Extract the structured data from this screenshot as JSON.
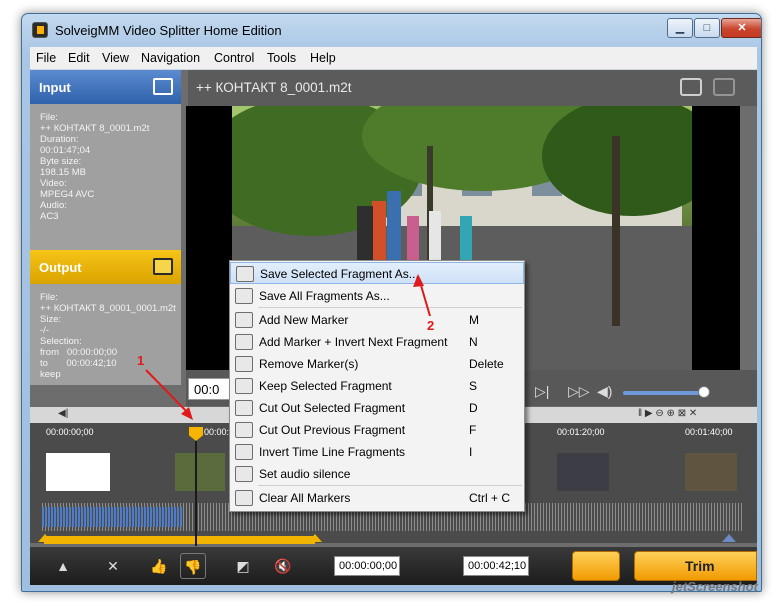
{
  "window": {
    "title": "SolveigMM Video Splitter Home Edition",
    "minimize": "▁",
    "maximize": "□",
    "close": "✕",
    "icon": "app-icon"
  },
  "menu": [
    "File",
    "Edit",
    "View",
    "Navigation",
    "Control",
    "Tools",
    "Help"
  ],
  "input_panel": {
    "header": "Input",
    "info": "File:\n++ КОНТАКТ 8_0001.m2t\nDuration:\n00:01:47;04\nByte size:\n198.15 MB\nVideo:\nMPEG4 AVC\nAudio:\nAC3",
    "icon": "folder-open-icon"
  },
  "output_panel": {
    "header": "Output",
    "info": "File:\n++ КОНТАКТ 8_0001_0001.m2t\nSize:\n-/-\nSelection:\nfrom   00:00:00;00\nto       00:00:42;10\nkeep",
    "icon": "floppy-disk-icon"
  },
  "video": {
    "title": "++ КОНТАКТ 8_0001.m2t",
    "timecode": "00:0",
    "camera_icon": "snapshot-icon",
    "volume": 0.9
  },
  "timeline": {
    "ruler": [
      "00:00:00;00",
      "00:00:20;00",
      "00:01:20;00",
      "00:01:40;00"
    ],
    "selection_fraction": 0.39
  },
  "bottom_bar": {
    "start_tc": "00:00:00;00",
    "end_tc": "00:00:42;10",
    "trim_label": "Trim"
  },
  "context_menu": [
    {
      "label": "Save Selected Fragment As...",
      "key": "",
      "highlighted": true
    },
    {
      "label": "Save All Fragments As...",
      "key": ""
    },
    {
      "label": "Add New Marker",
      "key": "M"
    },
    {
      "label": "Add Marker + Invert Next Fragment",
      "key": "N"
    },
    {
      "label": "Remove Marker(s)",
      "key": "Delete"
    },
    {
      "label": "Keep Selected Fragment",
      "key": "S"
    },
    {
      "label": "Cut Out Selected Fragment",
      "key": "D"
    },
    {
      "label": "Cut Out Previous Fragment",
      "key": "F"
    },
    {
      "label": "Invert Time Line Fragments",
      "key": "I"
    },
    {
      "label": "Set audio silence",
      "key": ""
    },
    {
      "label": "Clear All Markers",
      "key": "Ctrl + C"
    }
  ],
  "annotations": {
    "a1": "1",
    "a2": "2",
    "color": "#e01a1a"
  },
  "watermark": "jetScreenshot"
}
